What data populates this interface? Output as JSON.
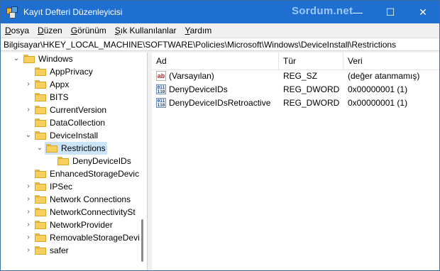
{
  "window": {
    "title": "Kayıt Defteri Düzenleyicisi",
    "watermark": "Sordum.net",
    "controls": {
      "minimize": "—",
      "maximize": "☐",
      "close": "✕"
    }
  },
  "menu": {
    "items": [
      {
        "underline": "D",
        "rest": "osya"
      },
      {
        "underline": "D",
        "rest": "üzen"
      },
      {
        "underline": "G",
        "rest": "örünüm"
      },
      {
        "underline": "Ş",
        "rest": "ık Kullanılanlar"
      },
      {
        "underline": "Y",
        "rest": "ardım"
      }
    ]
  },
  "address": "Bilgisayar\\HKEY_LOCAL_MACHINE\\SOFTWARE\\Policies\\Microsoft\\Windows\\DeviceInstall\\Restrictions",
  "tree": {
    "items": [
      {
        "label": "Windows",
        "expanded": true
      },
      {
        "label": "AppPrivacy",
        "expanded": false
      },
      {
        "label": "Appx",
        "expanded": false
      },
      {
        "label": "BITS",
        "expanded": false
      },
      {
        "label": "CurrentVersion",
        "expanded": false
      },
      {
        "label": "DataCollection",
        "expanded": false
      },
      {
        "label": "DeviceInstall",
        "expanded": true
      },
      {
        "label": "Restrictions",
        "expanded": true,
        "selected": true
      },
      {
        "label": "DenyDeviceIDs",
        "expanded": false
      },
      {
        "label": "EnhancedStorageDevic",
        "expanded": false
      },
      {
        "label": "IPSec",
        "expanded": false
      },
      {
        "label": "Network Connections",
        "expanded": false
      },
      {
        "label": "NetworkConnectivitySt",
        "expanded": false
      },
      {
        "label": "NetworkProvider",
        "expanded": false
      },
      {
        "label": "RemovableStorageDevi",
        "expanded": false
      },
      {
        "label": "safer",
        "expanded": false
      }
    ]
  },
  "list": {
    "columns": [
      "Ad",
      "Tür",
      "Veri"
    ],
    "rows": [
      {
        "name": "(Varsayılan)",
        "type": "REG_SZ",
        "data": "(değer atanmamış)",
        "icon": "string-value-icon"
      },
      {
        "name": "DenyDeviceIDs",
        "type": "REG_DWORD",
        "data": "0x00000001 (1)",
        "icon": "dword-value-icon"
      },
      {
        "name": "DenyDeviceIDsRetroactive",
        "type": "REG_DWORD",
        "data": "0x00000001 (1)",
        "icon": "dword-value-icon"
      }
    ]
  },
  "colors": {
    "titlebar": "#1f6fd1",
    "selection": "#cce4f7",
    "folder": "#f6cf5c"
  }
}
